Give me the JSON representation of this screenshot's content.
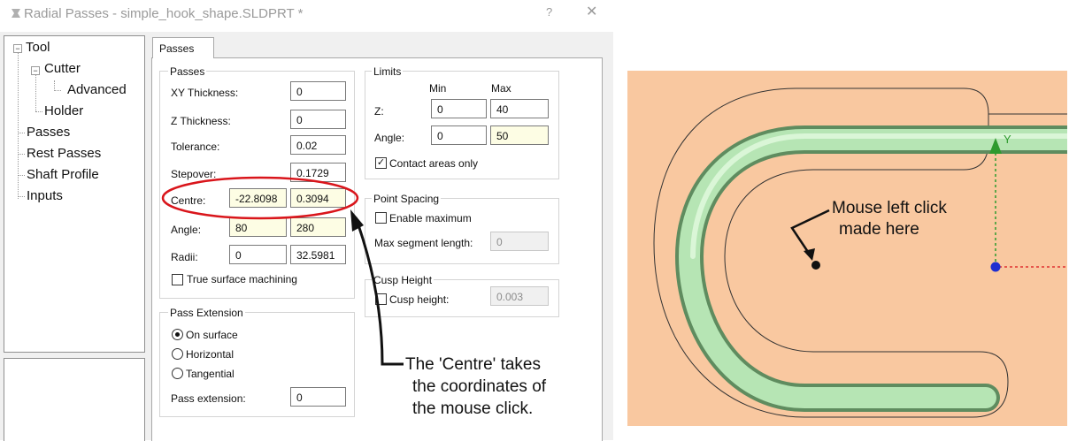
{
  "window": {
    "title": "Radial Passes - simple_hook_shape.SLDPRT *",
    "help_label": "?",
    "close_label": "✕"
  },
  "tree": {
    "items": [
      {
        "label": "Tool"
      },
      {
        "label": "Cutter"
      },
      {
        "label": "Advanced"
      },
      {
        "label": "Holder"
      },
      {
        "label": "Passes"
      },
      {
        "label": "Rest Passes"
      },
      {
        "label": "Shaft Profile"
      },
      {
        "label": "Inputs"
      }
    ],
    "expand_glyph": "−"
  },
  "tabs": {
    "passes_label": "Passes"
  },
  "passes": {
    "group_label": "Passes",
    "xy_thickness_label": "XY Thickness:",
    "xy_thickness": "0",
    "z_thickness_label": "Z Thickness:",
    "z_thickness": "0",
    "tolerance_label": "Tolerance:",
    "tolerance": "0.02",
    "stepover_label": "Stepover:",
    "stepover": "0.1729",
    "centre_label": "Centre:",
    "centre_x": "-22.8098",
    "centre_y": "0.3094",
    "angle_label": "Angle:",
    "angle_start": "80",
    "angle_end": "280",
    "radii_label": "Radii:",
    "radii_inner": "0",
    "radii_outer": "32.5981",
    "true_surface_label": "True surface machining"
  },
  "limits": {
    "group_label": "Limits",
    "min_label": "Min",
    "max_label": "Max",
    "z_label": "Z:",
    "z_min": "0",
    "z_max": "40",
    "angle_label": "Angle:",
    "angle_min": "0",
    "angle_max": "50",
    "contact_label": "Contact areas only"
  },
  "point_spacing": {
    "group_label": "Point Spacing",
    "enable_max_label": "Enable maximum",
    "max_segment_label": "Max segment length:",
    "max_segment": "0"
  },
  "cusp_height": {
    "group_label": "Cusp Height",
    "cusp_label": "Cusp height:",
    "cusp_value": "0.003"
  },
  "pass_extension": {
    "group_label": "Pass Extension",
    "on_surface_label": "On surface",
    "horizontal_label": "Horizontal",
    "tangential_label": "Tangential",
    "pass_ext_label": "Pass extension:",
    "pass_ext_value": "0"
  },
  "annotations": {
    "centre_line1": "The 'Centre' takes",
    "centre_line2": "the coordinates of",
    "centre_line3": "the mouse click.",
    "mouse_line1": "Mouse left click",
    "mouse_line2": "made here",
    "y_axis_label": "Y"
  },
  "colors": {
    "viewport_bg": "#f9c8a0",
    "tube": "#b6e5b4",
    "highlight_ellipse": "#d9151b",
    "axis_y": "#2e9a2e",
    "axis_x": "#e03030",
    "origin": "#1f2fd0"
  }
}
